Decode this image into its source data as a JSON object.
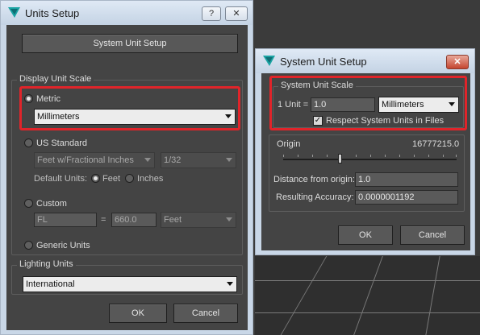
{
  "units_setup": {
    "title": "Units Setup",
    "help_label": "?",
    "close_label": "✕",
    "system_unit_setup_button": "System Unit Setup",
    "display_unit_scale": {
      "legend": "Display Unit Scale",
      "metric_label": "Metric",
      "metric_selected": true,
      "metric_unit": "Millimeters",
      "us_standard_label": "US Standard",
      "us_format": "Feet w/Fractional Inches",
      "us_fraction": "1/32",
      "default_units_label": "Default Units:",
      "feet_label": "Feet",
      "inches_label": "Inches",
      "custom_label": "Custom",
      "custom_name": "FL",
      "custom_equals": "=",
      "custom_value": "660.0",
      "custom_unit": "Feet",
      "generic_label": "Generic Units"
    },
    "lighting_units": {
      "legend": "Lighting Units",
      "value": "International"
    },
    "ok_label": "OK",
    "cancel_label": "Cancel"
  },
  "system_unit_setup": {
    "title": "System Unit Setup",
    "close_label": "✕",
    "system_unit_scale": {
      "legend": "System Unit Scale",
      "unit_prefix": "1 Unit =",
      "unit_value": "1.0",
      "unit_type": "Millimeters",
      "respect_label": "Respect System Units in Files",
      "respect_checked": true
    },
    "origin_label": "Origin",
    "origin_value": "16777215.0",
    "distance_label": "Distance from origin:",
    "distance_value": "1.0",
    "accuracy_label": "Resulting Accuracy:",
    "accuracy_value": "0.0000001192",
    "ok_label": "OK",
    "cancel_label": "Cancel"
  }
}
